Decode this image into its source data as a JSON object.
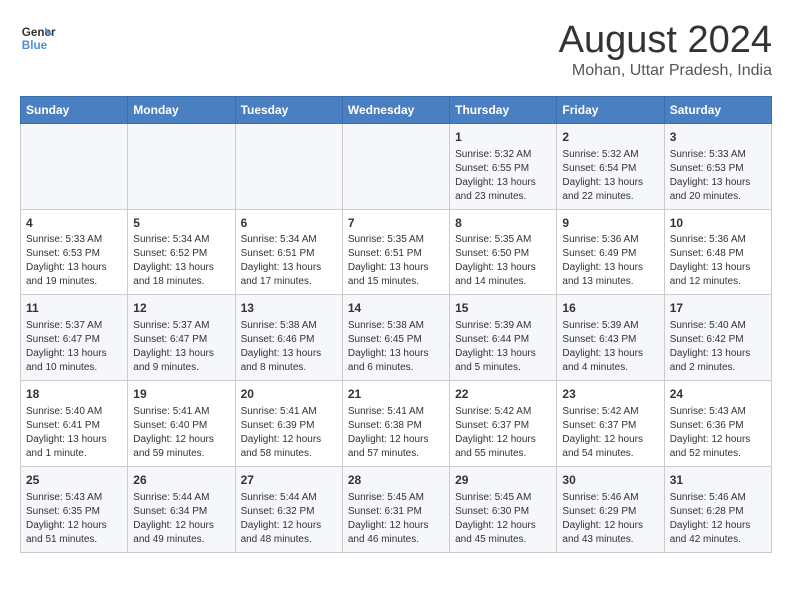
{
  "logo": {
    "line1": "General",
    "line2": "Blue"
  },
  "title": "August 2024",
  "subtitle": "Mohan, Uttar Pradesh, India",
  "days_of_week": [
    "Sunday",
    "Monday",
    "Tuesday",
    "Wednesday",
    "Thursday",
    "Friday",
    "Saturday"
  ],
  "weeks": [
    [
      {
        "day": "",
        "content": ""
      },
      {
        "day": "",
        "content": ""
      },
      {
        "day": "",
        "content": ""
      },
      {
        "day": "",
        "content": ""
      },
      {
        "day": "1",
        "content": "Sunrise: 5:32 AM\nSunset: 6:55 PM\nDaylight: 13 hours\nand 23 minutes."
      },
      {
        "day": "2",
        "content": "Sunrise: 5:32 AM\nSunset: 6:54 PM\nDaylight: 13 hours\nand 22 minutes."
      },
      {
        "day": "3",
        "content": "Sunrise: 5:33 AM\nSunset: 6:53 PM\nDaylight: 13 hours\nand 20 minutes."
      }
    ],
    [
      {
        "day": "4",
        "content": "Sunrise: 5:33 AM\nSunset: 6:53 PM\nDaylight: 13 hours\nand 19 minutes."
      },
      {
        "day": "5",
        "content": "Sunrise: 5:34 AM\nSunset: 6:52 PM\nDaylight: 13 hours\nand 18 minutes."
      },
      {
        "day": "6",
        "content": "Sunrise: 5:34 AM\nSunset: 6:51 PM\nDaylight: 13 hours\nand 17 minutes."
      },
      {
        "day": "7",
        "content": "Sunrise: 5:35 AM\nSunset: 6:51 PM\nDaylight: 13 hours\nand 15 minutes."
      },
      {
        "day": "8",
        "content": "Sunrise: 5:35 AM\nSunset: 6:50 PM\nDaylight: 13 hours\nand 14 minutes."
      },
      {
        "day": "9",
        "content": "Sunrise: 5:36 AM\nSunset: 6:49 PM\nDaylight: 13 hours\nand 13 minutes."
      },
      {
        "day": "10",
        "content": "Sunrise: 5:36 AM\nSunset: 6:48 PM\nDaylight: 13 hours\nand 12 minutes."
      }
    ],
    [
      {
        "day": "11",
        "content": "Sunrise: 5:37 AM\nSunset: 6:47 PM\nDaylight: 13 hours\nand 10 minutes."
      },
      {
        "day": "12",
        "content": "Sunrise: 5:37 AM\nSunset: 6:47 PM\nDaylight: 13 hours\nand 9 minutes."
      },
      {
        "day": "13",
        "content": "Sunrise: 5:38 AM\nSunset: 6:46 PM\nDaylight: 13 hours\nand 8 minutes."
      },
      {
        "day": "14",
        "content": "Sunrise: 5:38 AM\nSunset: 6:45 PM\nDaylight: 13 hours\nand 6 minutes."
      },
      {
        "day": "15",
        "content": "Sunrise: 5:39 AM\nSunset: 6:44 PM\nDaylight: 13 hours\nand 5 minutes."
      },
      {
        "day": "16",
        "content": "Sunrise: 5:39 AM\nSunset: 6:43 PM\nDaylight: 13 hours\nand 4 minutes."
      },
      {
        "day": "17",
        "content": "Sunrise: 5:40 AM\nSunset: 6:42 PM\nDaylight: 13 hours\nand 2 minutes."
      }
    ],
    [
      {
        "day": "18",
        "content": "Sunrise: 5:40 AM\nSunset: 6:41 PM\nDaylight: 13 hours\nand 1 minute."
      },
      {
        "day": "19",
        "content": "Sunrise: 5:41 AM\nSunset: 6:40 PM\nDaylight: 12 hours\nand 59 minutes."
      },
      {
        "day": "20",
        "content": "Sunrise: 5:41 AM\nSunset: 6:39 PM\nDaylight: 12 hours\nand 58 minutes."
      },
      {
        "day": "21",
        "content": "Sunrise: 5:41 AM\nSunset: 6:38 PM\nDaylight: 12 hours\nand 57 minutes."
      },
      {
        "day": "22",
        "content": "Sunrise: 5:42 AM\nSunset: 6:37 PM\nDaylight: 12 hours\nand 55 minutes."
      },
      {
        "day": "23",
        "content": "Sunrise: 5:42 AM\nSunset: 6:37 PM\nDaylight: 12 hours\nand 54 minutes."
      },
      {
        "day": "24",
        "content": "Sunrise: 5:43 AM\nSunset: 6:36 PM\nDaylight: 12 hours\nand 52 minutes."
      }
    ],
    [
      {
        "day": "25",
        "content": "Sunrise: 5:43 AM\nSunset: 6:35 PM\nDaylight: 12 hours\nand 51 minutes."
      },
      {
        "day": "26",
        "content": "Sunrise: 5:44 AM\nSunset: 6:34 PM\nDaylight: 12 hours\nand 49 minutes."
      },
      {
        "day": "27",
        "content": "Sunrise: 5:44 AM\nSunset: 6:32 PM\nDaylight: 12 hours\nand 48 minutes."
      },
      {
        "day": "28",
        "content": "Sunrise: 5:45 AM\nSunset: 6:31 PM\nDaylight: 12 hours\nand 46 minutes."
      },
      {
        "day": "29",
        "content": "Sunrise: 5:45 AM\nSunset: 6:30 PM\nDaylight: 12 hours\nand 45 minutes."
      },
      {
        "day": "30",
        "content": "Sunrise: 5:46 AM\nSunset: 6:29 PM\nDaylight: 12 hours\nand 43 minutes."
      },
      {
        "day": "31",
        "content": "Sunrise: 5:46 AM\nSunset: 6:28 PM\nDaylight: 12 hours\nand 42 minutes."
      }
    ]
  ]
}
